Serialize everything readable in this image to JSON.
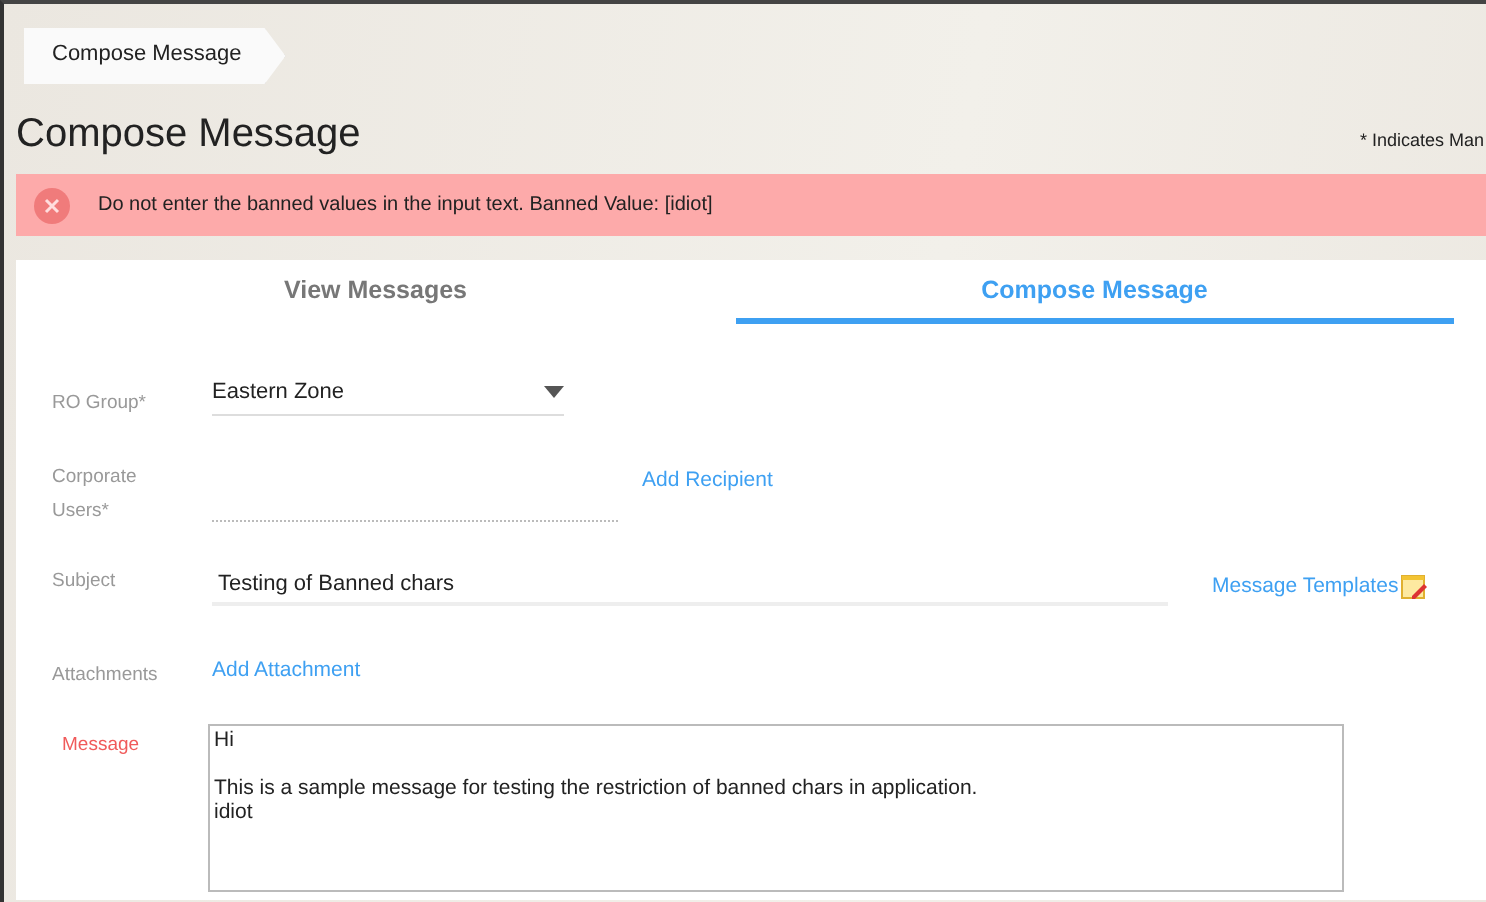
{
  "breadcrumb": "Compose Message",
  "page_title": "Compose Message",
  "mandatory_note": "* Indicates Man",
  "error": {
    "message": "Do not enter the banned values in the input text. Banned Value: [idiot]"
  },
  "tabs": [
    {
      "label": "View Messages",
      "selected": false
    },
    {
      "label": "Compose Message",
      "selected": true
    }
  ],
  "form": {
    "ro_group": {
      "label": "RO Group*",
      "value": "Eastern Zone"
    },
    "corporate_users": {
      "label_lines": [
        "Corporate",
        "Users*"
      ],
      "link": "Add Recipient"
    },
    "subject": {
      "label": "Subject",
      "value": "Testing of Banned chars",
      "link": "Message Templates"
    },
    "attachments": {
      "label": "Attachments",
      "link": "Add Attachment"
    },
    "message": {
      "label": "Message",
      "error": true,
      "value": "Hi\n\nThis is a sample message for testing the restriction of banned chars in application.\nidiot"
    }
  }
}
